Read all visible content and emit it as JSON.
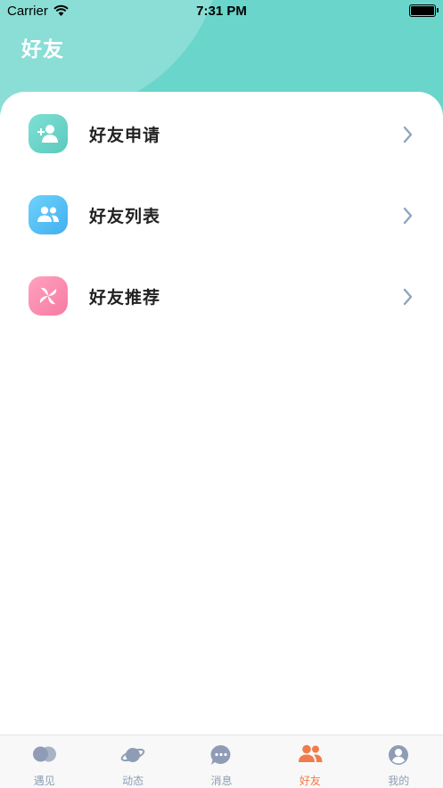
{
  "status_bar": {
    "carrier": "Carrier",
    "time": "7:31 PM"
  },
  "header": {
    "title": "好友"
  },
  "menu": {
    "items": [
      {
        "label": "好友申请",
        "icon": "add-friend-icon",
        "color": "#6AD5CB"
      },
      {
        "label": "好友列表",
        "icon": "friends-list-icon",
        "color": "#52BFF5"
      },
      {
        "label": "好友推荐",
        "icon": "pinwheel-icon",
        "color": "#FA88AC"
      }
    ]
  },
  "tabbar": {
    "items": [
      {
        "label": "遇见",
        "icon": "encounter-icon",
        "active": false
      },
      {
        "label": "动态",
        "icon": "planet-icon",
        "active": false
      },
      {
        "label": "消息",
        "icon": "message-icon",
        "active": false
      },
      {
        "label": "好友",
        "icon": "friends-icon",
        "active": true
      },
      {
        "label": "我的",
        "icon": "profile-icon",
        "active": false
      }
    ],
    "inactive_color": "#8E9DB5",
    "active_color": "#F27B4B"
  },
  "colors": {
    "header_bg": "#6AD5CB"
  }
}
